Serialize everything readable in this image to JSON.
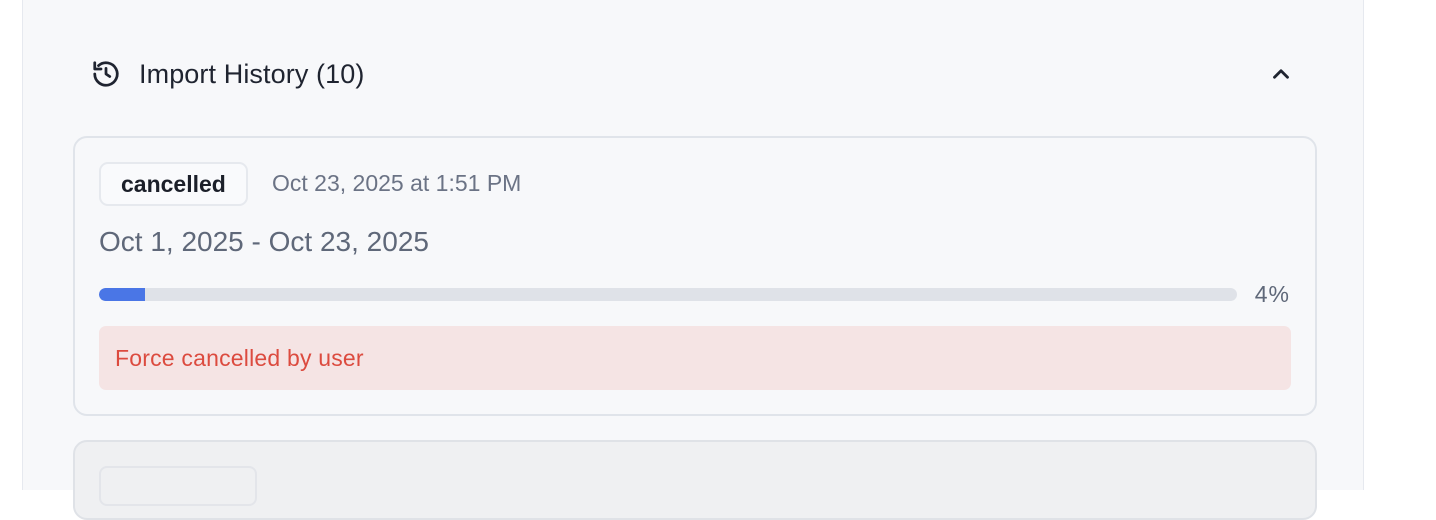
{
  "section": {
    "title": "Import History (10)",
    "icon": "history-icon",
    "toggle_icon": "chevron-up-icon"
  },
  "imports": [
    {
      "status": "cancelled",
      "timestamp": "Oct 23, 2025 at 1:51 PM",
      "date_range": "Oct 1, 2025 - Oct 23, 2025",
      "progress_percent": 4,
      "progress_label": "4%",
      "message": "Force cancelled by user"
    }
  ],
  "colors": {
    "progress_fill": "#4a76e6",
    "progress_track": "#dfe2e8",
    "error_text": "#dc4b3f",
    "error_bg": "#f5e4e4"
  }
}
